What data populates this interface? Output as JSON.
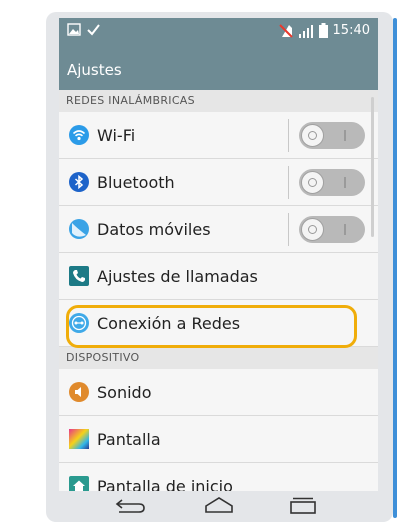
{
  "status": {
    "time": "15:40"
  },
  "header": {
    "title": "Ajustes"
  },
  "sections": {
    "wireless": "REDES INALÁMBRICAS",
    "device": "DISPOSITIVO"
  },
  "items": {
    "wifi": "Wi-Fi",
    "bluetooth": "Bluetooth",
    "mobile_data": "Datos móviles",
    "call_settings": "Ajustes de llamadas",
    "networks": "Conexión a Redes",
    "sound": "Sonido",
    "display": "Pantalla",
    "home_screen": "Pantalla de inicio"
  },
  "icons": {
    "wifi": "wifi-icon",
    "bluetooth": "bluetooth-icon",
    "mobile_data": "mobile-data-icon",
    "call_settings": "phone-icon",
    "networks": "network-connection-icon",
    "sound": "speaker-icon",
    "display": "display-icon",
    "home_screen": "home-icon"
  },
  "colors": {
    "header": "#6e8b94",
    "highlight": "#f0ad0a",
    "wifi": "#2b9be8",
    "bluetooth": "#1d63c9"
  }
}
